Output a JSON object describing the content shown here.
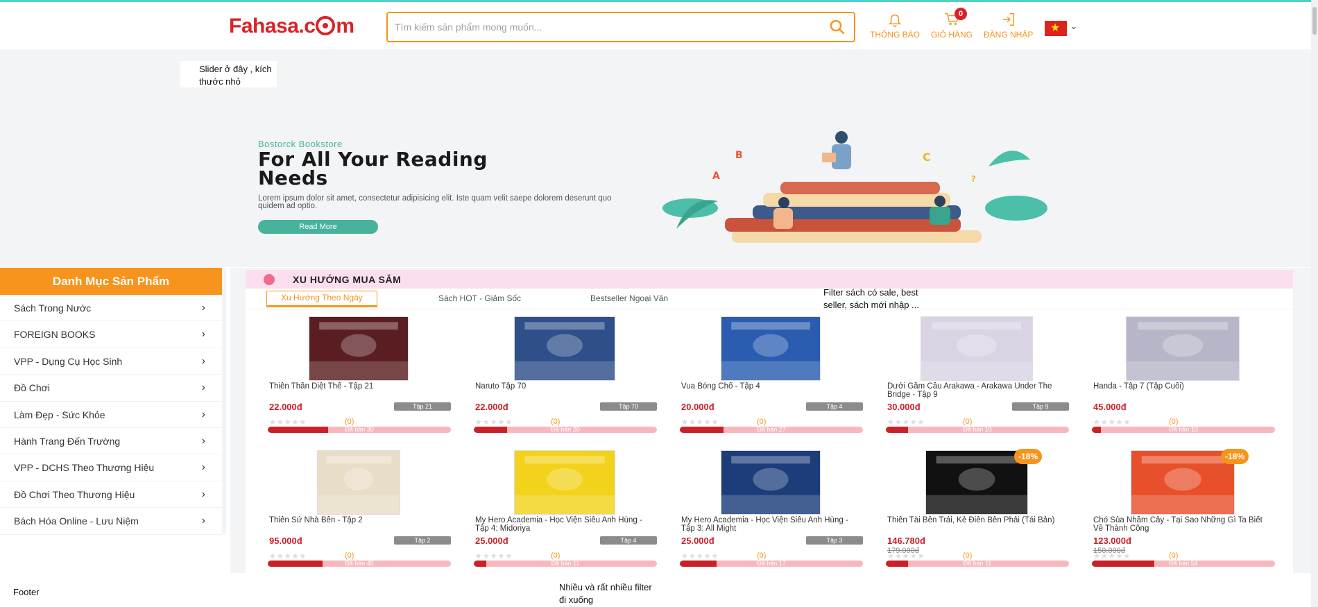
{
  "header": {
    "logo": "Fahasa.com",
    "search_placeholder": "Tìm kiếm sản phẩm mong muốn...",
    "notifications_label": "THÔNG BÁO",
    "cart_label": "GIỎ HÀNG",
    "cart_count": "0",
    "login_label": "ĐĂNG NHẬP",
    "language": "vi"
  },
  "notes": {
    "slider": "Slider ở đây , kích thước nhỏ",
    "filter": "Filter sách có sale, best seller, sách mới nhập ...",
    "more": "Nhiều và rất nhiều filter đi xuống",
    "footer": "Footer"
  },
  "banner": {
    "store": "Bostorck Bookstore",
    "title": "For All Your Reading Needs",
    "desc": "Lorem ipsum dolor sit amet, consectetur adipisicing elit. Iste quam velit saepe dolorem deserunt quo quidem ad optio.",
    "button": "Read More"
  },
  "sidebar": {
    "title": "Danh Mục Sản Phẩm",
    "items": [
      {
        "label": "Sách Trong Nước"
      },
      {
        "label": "FOREIGN BOOKS"
      },
      {
        "label": "VPP - Dụng Cụ Học Sinh"
      },
      {
        "label": "Đồ Chơi"
      },
      {
        "label": "Làm Đẹp - Sức Khỏe"
      },
      {
        "label": "Hành Trang Đến Trường"
      },
      {
        "label": "VPP - DCHS Theo Thương Hiệu"
      },
      {
        "label": "Đồ Chơi Theo Thương Hiệu"
      },
      {
        "label": "Bách Hóa Online - Lưu Niệm"
      }
    ]
  },
  "trend": {
    "title": "XU HƯỚNG MUA SẮM",
    "tabs": [
      "Xu Hướng Theo Ngày",
      "Sách HOT - Giảm Sốc",
      "Bestseller Ngoại Văn"
    ]
  },
  "products": [
    {
      "name": "Thiên Thần Diệt Thế - Tập 21",
      "price": "22.000đ",
      "old_price": "",
      "tag": "Tập 21",
      "rating_count": "(0)",
      "sold_label": "Đã bán 30",
      "sold_ratio": 0.33,
      "discount": "",
      "cover_color": "#5a1e22"
    },
    {
      "name": "Naruto Tập 70",
      "price": "22.000đ",
      "old_price": "",
      "tag": "Tập 70",
      "rating_count": "(0)",
      "sold_label": "Đã bán 20",
      "sold_ratio": 0.18,
      "discount": "",
      "cover_color": "#2f4f8a"
    },
    {
      "name": "Vua Bóng Chổ - Tập 4",
      "price": "20.000đ",
      "old_price": "",
      "tag": "Tập 4",
      "rating_count": "(0)",
      "sold_label": "Đã bán 27",
      "sold_ratio": 0.24,
      "discount": "",
      "cover_color": "#2a5db0"
    },
    {
      "name": "Dưới Gầm Cầu Arakawa - Arakawa Under The Bridge - Tập 9",
      "price": "30.000đ",
      "old_price": "",
      "tag": "Tập 9",
      "rating_count": "(0)",
      "sold_label": "Đã bán 10",
      "sold_ratio": 0.12,
      "discount": "",
      "cover_color": "#d9d3e3"
    },
    {
      "name": "Handa - Tập 7 (Tập Cuối)",
      "price": "45.000đ",
      "old_price": "",
      "tag": "",
      "rating_count": "(0)",
      "sold_label": "Đã bán 10",
      "sold_ratio": 0.05,
      "discount": "",
      "cover_color": "#b7b6c9"
    },
    {
      "name": "Thiên Sứ Nhà Bên - Tập 2",
      "price": "95.000đ",
      "old_price": "",
      "tag": "Tập 2",
      "rating_count": "(0)",
      "sold_label": "Đã bán 45",
      "sold_ratio": 0.3,
      "discount": "",
      "cover_color": "#e8ddc7"
    },
    {
      "name": "My Hero Academia - Học Viện Siêu Anh Hùng - Tập 4: Midoriya",
      "price": "25.000đ",
      "old_price": "",
      "tag": "Tập 4",
      "rating_count": "(0)",
      "sold_label": "Đã bán 11",
      "sold_ratio": 0.07,
      "discount": "",
      "cover_color": "#f2d21a"
    },
    {
      "name": "My Hero Academia - Học Viện Siêu Anh Hùng - Tập 3: All Might",
      "price": "25.000đ",
      "old_price": "",
      "tag": "Tập 3",
      "rating_count": "(0)",
      "sold_label": "Đã bán 17",
      "sold_ratio": 0.2,
      "discount": "",
      "cover_color": "#1c3d7a"
    },
    {
      "name": "Thiên Tài Bên Trái, Kẻ Điên Bên Phải (Tái Bản)",
      "price": "146.780đ",
      "old_price": "179.000đ",
      "tag": "",
      "rating_count": "(0)",
      "sold_label": "Đã bán 11",
      "sold_ratio": 0.12,
      "discount": "-18%",
      "cover_color": "#111111"
    },
    {
      "name": "Chó Sủa Nhầm Cây - Tại Sao Những Gì Ta Biết Về Thành Công",
      "price": "123.000đ",
      "old_price": "150.000đ",
      "tag": "",
      "rating_count": "(0)",
      "sold_label": "Đã bán 54",
      "sold_ratio": 0.34,
      "discount": "-18%",
      "cover_color": "#e8502c"
    }
  ],
  "colors": {
    "brand": "#d8232a",
    "accent": "#f7941d",
    "banner_green": "#47b39c",
    "trend_bg": "#fcdfee"
  }
}
